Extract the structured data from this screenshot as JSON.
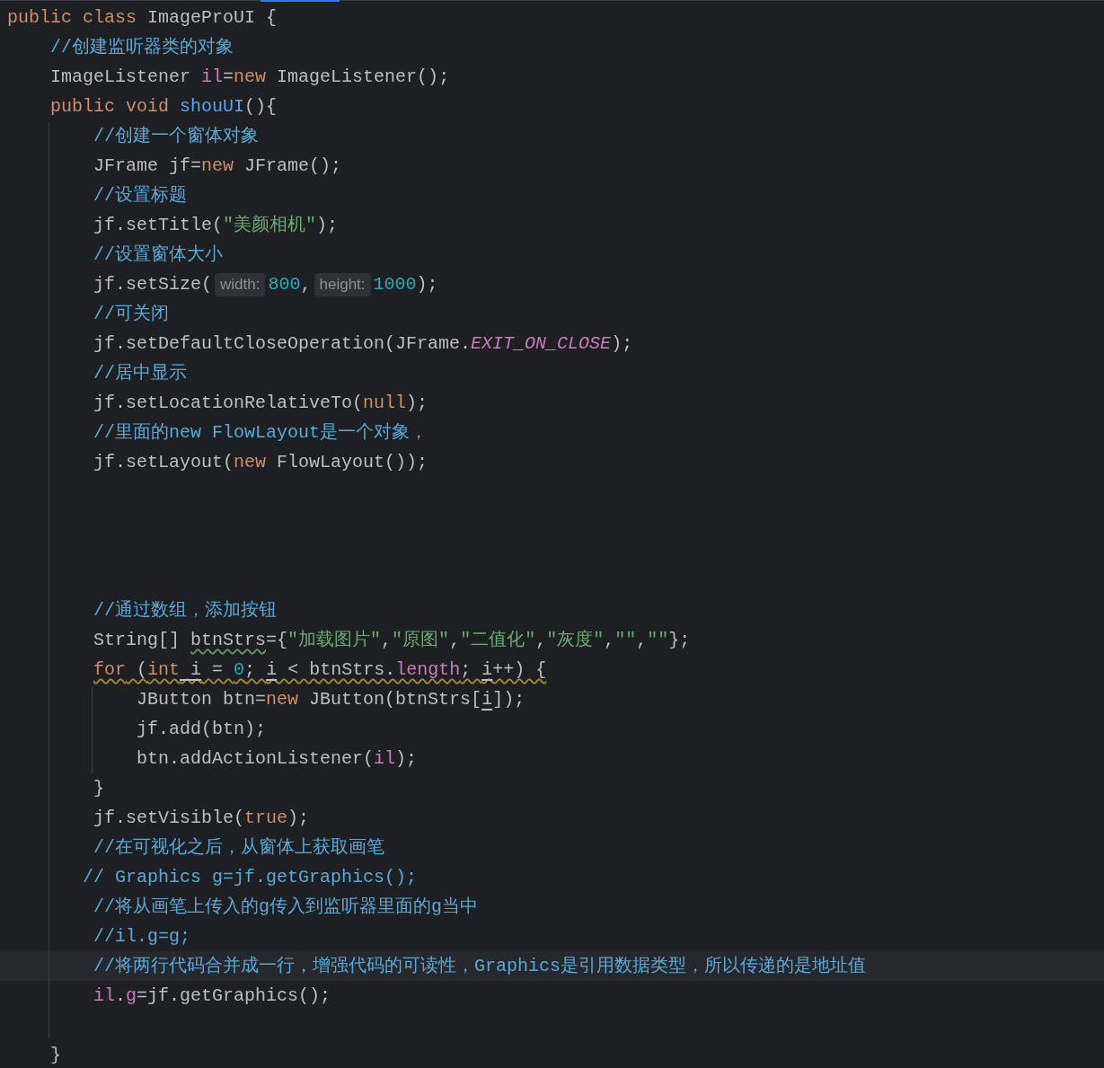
{
  "editor": {
    "lines": [
      {
        "current": false,
        "code": [
          {
            "kind": "keyword",
            "text": "public class"
          },
          {
            "kind": "plain",
            "text": " ImageProUI {"
          }
        ]
      },
      {
        "current": false,
        "code": [
          {
            "kind": "comment",
            "text": "    //创建监听器类的对象"
          }
        ]
      },
      {
        "current": false,
        "code": [
          {
            "kind": "plain",
            "text": "    ImageListener "
          },
          {
            "kind": "field",
            "text": "il"
          },
          {
            "kind": "plain",
            "text": "="
          },
          {
            "kind": "keyword",
            "text": "new"
          },
          {
            "kind": "plain",
            "text": " ImageListener();"
          }
        ]
      },
      {
        "current": false,
        "code": [
          {
            "kind": "keyword",
            "text": "    public void"
          },
          {
            "kind": "method",
            "text": " shouUI"
          },
          {
            "kind": "plain",
            "text": "(){"
          }
        ]
      },
      {
        "current": false,
        "code": [
          {
            "kind": "comment",
            "text": "        //创建一个窗体对象"
          }
        ]
      },
      {
        "current": false,
        "code": [
          {
            "kind": "plain",
            "text": "        JFrame jf="
          },
          {
            "kind": "keyword",
            "text": "new"
          },
          {
            "kind": "plain",
            "text": " JFrame();"
          }
        ]
      },
      {
        "current": false,
        "code": [
          {
            "kind": "comment",
            "text": "        //设置标题"
          }
        ]
      },
      {
        "current": false,
        "code": [
          {
            "kind": "plain",
            "text": "        jf.setTitle("
          },
          {
            "kind": "string",
            "text": "\"美颜相机\""
          },
          {
            "kind": "plain",
            "text": ");"
          }
        ]
      },
      {
        "current": false,
        "code": [
          {
            "kind": "comment",
            "text": "        //设置窗体大小"
          }
        ]
      },
      {
        "current": false,
        "code": [
          {
            "kind": "plain",
            "text": "        jf.setSize("
          },
          {
            "kind": "hint",
            "text": "width:"
          },
          {
            "kind": "number",
            "text": "800"
          },
          {
            "kind": "plain",
            "text": ","
          },
          {
            "kind": "hint",
            "text": "height:"
          },
          {
            "kind": "number",
            "text": "1000"
          },
          {
            "kind": "plain",
            "text": ");"
          }
        ]
      },
      {
        "current": false,
        "code": [
          {
            "kind": "comment",
            "text": "        //可关闭"
          }
        ]
      },
      {
        "current": false,
        "code": [
          {
            "kind": "plain",
            "text": "        jf.setDefaultCloseOperation(JFrame."
          },
          {
            "kind": "constant",
            "text": "EXIT_ON_CLOSE"
          },
          {
            "kind": "plain",
            "text": ");"
          }
        ]
      },
      {
        "current": false,
        "code": [
          {
            "kind": "comment",
            "text": "        //居中显示"
          }
        ]
      },
      {
        "current": false,
        "code": [
          {
            "kind": "plain",
            "text": "        jf.setLocationRelativeTo("
          },
          {
            "kind": "keyword",
            "text": "null"
          },
          {
            "kind": "plain",
            "text": ");"
          }
        ]
      },
      {
        "current": false,
        "code": [
          {
            "kind": "comment",
            "text": "        //里面的new FlowLayout是一个对象，"
          }
        ]
      },
      {
        "current": false,
        "code": [
          {
            "kind": "plain",
            "text": "        jf.setLayout("
          },
          {
            "kind": "keyword",
            "text": "new"
          },
          {
            "kind": "plain",
            "text": " FlowLayout());"
          }
        ]
      },
      {
        "current": false
      },
      {
        "current": false
      },
      {
        "current": false
      },
      {
        "current": false
      },
      {
        "current": false,
        "code": [
          {
            "kind": "comment",
            "text": "        //通过数组，添加按钮"
          }
        ]
      },
      {
        "current": false,
        "code": [
          {
            "kind": "plain",
            "text": "        String[] "
          },
          {
            "kind": "typo",
            "text": "btnStrs"
          },
          {
            "kind": "plain",
            "text": "={"
          },
          {
            "kind": "string",
            "text": "\"加载图片\""
          },
          {
            "kind": "plain",
            "text": ","
          },
          {
            "kind": "string",
            "text": "\"原图\""
          },
          {
            "kind": "plain",
            "text": ","
          },
          {
            "kind": "string",
            "text": "\"二值化\""
          },
          {
            "kind": "plain",
            "text": ","
          },
          {
            "kind": "string",
            "text": "\"灰度\""
          },
          {
            "kind": "plain",
            "text": ","
          },
          {
            "kind": "string",
            "text": "\"\""
          },
          {
            "kind": "plain",
            "text": ","
          },
          {
            "kind": "string",
            "text": "\"\""
          },
          {
            "kind": "plain",
            "text": "};"
          }
        ]
      },
      {
        "current": false,
        "warning": true,
        "code": [
          {
            "kind": "keyword",
            "text": "        for"
          },
          {
            "kind": "plain",
            "text": " ("
          },
          {
            "kind": "keyword",
            "text": "int"
          },
          {
            "kind": "usage",
            "text": " i"
          },
          {
            "kind": "plain",
            "text": " = "
          },
          {
            "kind": "number",
            "text": "0"
          },
          {
            "kind": "plain",
            "text": "; "
          },
          {
            "kind": "usage",
            "text": "i"
          },
          {
            "kind": "plain",
            "text": " < btnStrs."
          },
          {
            "kind": "field",
            "text": "length"
          },
          {
            "kind": "plain",
            "text": "; "
          },
          {
            "kind": "usage",
            "text": "i"
          },
          {
            "kind": "plain",
            "text": "++) {"
          }
        ]
      },
      {
        "current": false,
        "code": [
          {
            "kind": "plain",
            "text": "            JButton btn="
          },
          {
            "kind": "keyword",
            "text": "new"
          },
          {
            "kind": "plain",
            "text": " JButton(btnStrs["
          },
          {
            "kind": "usage",
            "text": "i"
          },
          {
            "kind": "plain",
            "text": "]);"
          }
        ]
      },
      {
        "current": false,
        "code": [
          {
            "kind": "plain",
            "text": "            jf.add(btn);"
          }
        ]
      },
      {
        "current": false,
        "code": [
          {
            "kind": "plain",
            "text": "            btn.addActionListener("
          },
          {
            "kind": "field",
            "text": "il"
          },
          {
            "kind": "plain",
            "text": ");"
          }
        ]
      },
      {
        "current": false,
        "code": [
          {
            "kind": "plain",
            "text": "        }"
          }
        ]
      },
      {
        "current": false,
        "code": [
          {
            "kind": "plain",
            "text": "        jf.setVisible("
          },
          {
            "kind": "keyword",
            "text": "true"
          },
          {
            "kind": "plain",
            "text": ");"
          }
        ]
      },
      {
        "current": false,
        "code": [
          {
            "kind": "comment",
            "text": "        //在可视化之后，从窗体上获取画笔"
          }
        ]
      },
      {
        "current": false,
        "code": [
          {
            "kind": "comment",
            "text": "       // Graphics g=jf.getGraphics();"
          }
        ]
      },
      {
        "current": false,
        "code": [
          {
            "kind": "comment",
            "text": "        //将从画笔上传入的g传入到监听器里面的g当中"
          }
        ]
      },
      {
        "current": false,
        "code": [
          {
            "kind": "comment",
            "text": "        //il.g=g;"
          }
        ]
      },
      {
        "current": true,
        "code": [
          {
            "kind": "comment",
            "text": "        //将两行代码合并成一行，增强代码的可读性，Graphics是引用数据类型，所以传递的是地址值"
          }
        ]
      },
      {
        "current": false,
        "code": [
          {
            "kind": "field",
            "text": "        il"
          },
          {
            "kind": "plain",
            "text": "."
          },
          {
            "kind": "field",
            "text": "g"
          },
          {
            "kind": "plain",
            "text": "=jf.getGraphics();"
          }
        ]
      },
      {
        "current": false
      },
      {
        "current": false,
        "code": [
          {
            "kind": "plain",
            "text": "    }"
          }
        ]
      }
    ]
  }
}
